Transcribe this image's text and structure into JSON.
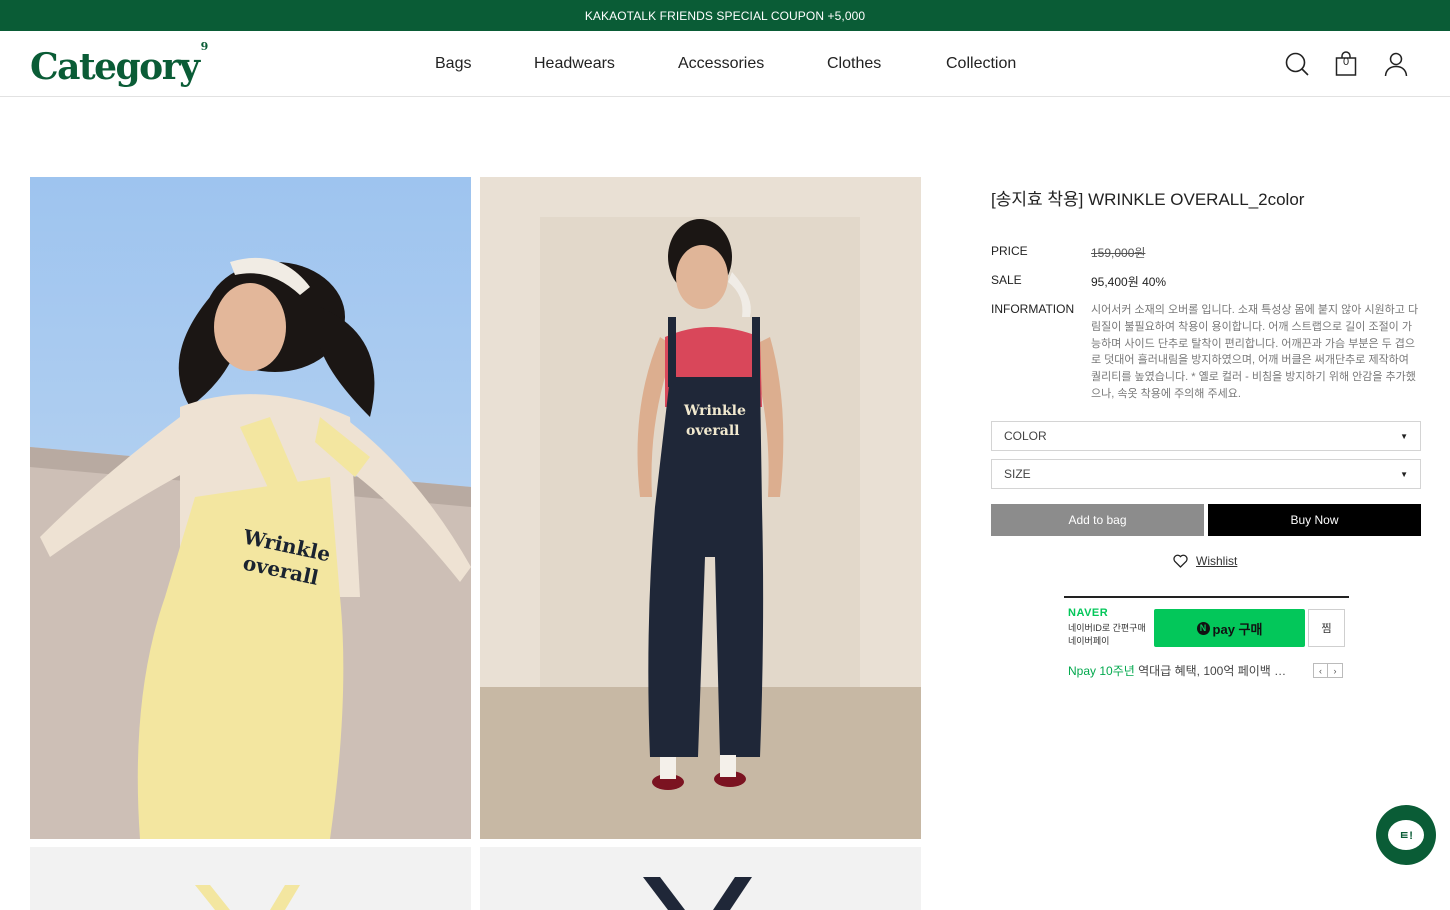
{
  "topbar": {
    "text": "KAKAOTALK FRIENDS SPECIAL COUPON +5,000"
  },
  "header": {
    "logo": "Category",
    "logo_mark": "9",
    "nav": [
      "Bags",
      "Headwears",
      "Accessories",
      "Clothes",
      "Collection"
    ],
    "cart_count": "0",
    "icons": [
      "search-icon",
      "bag-icon",
      "user-icon"
    ]
  },
  "photos": {
    "main_left": {
      "caption": "Wrinkle overall",
      "garment_color": "#f3e6a0"
    },
    "main_right": {
      "caption_line1": "Wrinkle",
      "caption_line2": "overall",
      "garment_color": "#1f2738"
    }
  },
  "product": {
    "title": "[송지효 착용] WRINKLE OVERALL_2color",
    "price_label": "PRICE",
    "price": "159,000원",
    "sale_label": "SALE",
    "sale": "95,400원 40%",
    "info_label": "INFORMATION",
    "info": "시어서커 소재의 오버롤 입니다. 소재 특성상 몸에 붙지 않아 시원하고 다림질이 불필요하여 착용이 용이합니다. 어깨 스트랩으로 길이 조절이 가능하며 사이드 단추로 탈착이 편리합니다. 어깨끈과 가슴 부분은 두 겹으로 덧대어 흘러내림을 방지하였으며, 어깨 버클은 써개단추로 제작하여 퀄리티를 높였습니다. * 옐로 컬러 - 비침을 방지하기 위해 안감을 추가했으나, 속옷 착용에 주의해 주세요.",
    "color_select": "COLOR",
    "size_select": "SIZE",
    "add_to_bag": "Add to bag",
    "buy_now": "Buy Now",
    "wishlist": "Wishlist"
  },
  "npay": {
    "brand": "NAVER",
    "sub1": "네이버ID로 간편구매",
    "sub2": "네이버페이",
    "button_badge": "N",
    "button_text": "pay 구매",
    "jjim": "찜",
    "promo_highlight": "Npay 10주년",
    "promo_rest": " 역대급 혜택, 100억 페이백 …"
  },
  "chat": {
    "label": "ㅌ!"
  },
  "colors": {
    "brand_green": "#0a5c36",
    "npay_green": "#03c75a"
  }
}
